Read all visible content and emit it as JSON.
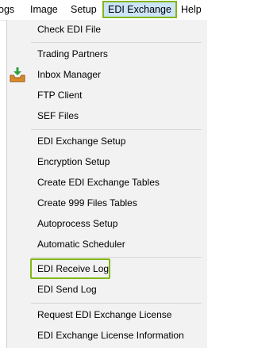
{
  "menubar": {
    "items": [
      "ogs",
      "Image",
      "Setup",
      "EDI Exchange",
      "Help"
    ],
    "active": "EDI Exchange"
  },
  "menu": {
    "group1": [
      "Check EDI File"
    ],
    "group2": [
      "Trading Partners",
      "Inbox Manager",
      "FTP Client",
      "SEF Files"
    ],
    "group3": [
      "EDI Exchange Setup",
      "Encryption Setup",
      "Create EDI Exchange Tables",
      "Create 999 Files Tables",
      "Autoprocess Setup",
      "Automatic Scheduler"
    ],
    "group4": [
      "EDI Receive Log",
      "EDI Send Log"
    ],
    "group5": [
      "Request EDI Exchange License",
      "EDI Exchange License Information"
    ],
    "highlighted": "EDI Receive Log"
  },
  "colors": {
    "highlight_border": "#82b816",
    "active_menu_bg": "#cce4f7",
    "dropdown_bg": "#f2f2f2"
  },
  "icons": {
    "inbox_manager": "inbox-tray-icon"
  }
}
